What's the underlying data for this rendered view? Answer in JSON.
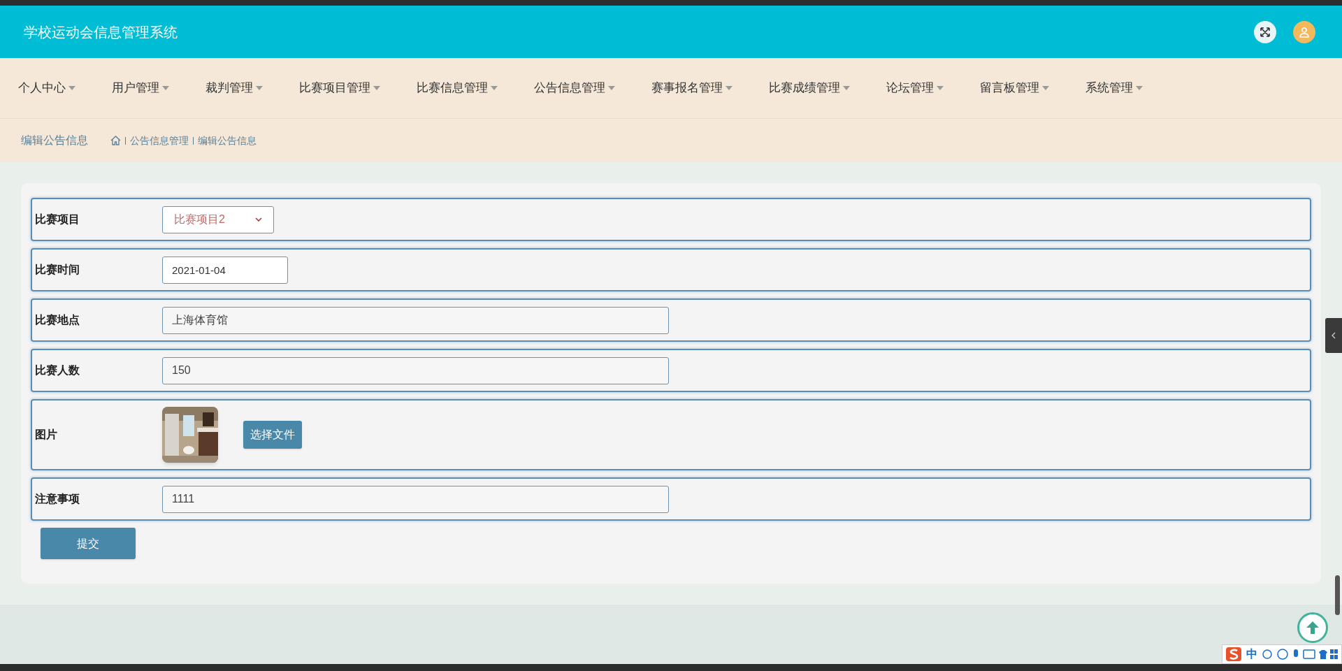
{
  "header": {
    "title": "学校运动会信息管理系统"
  },
  "nav": [
    {
      "label": "个人中心"
    },
    {
      "label": "用户管理"
    },
    {
      "label": "裁判管理"
    },
    {
      "label": "比赛项目管理"
    },
    {
      "label": "比赛信息管理"
    },
    {
      "label": "公告信息管理"
    },
    {
      "label": "赛事报名管理"
    },
    {
      "label": "比赛成绩管理"
    },
    {
      "label": "论坛管理"
    },
    {
      "label": "留言板管理"
    },
    {
      "label": "系统管理"
    }
  ],
  "breadcrumb": {
    "page_title": "编辑公告信息",
    "path": [
      "公告信息管理",
      "编辑公告信息"
    ]
  },
  "form": {
    "fields": [
      {
        "kind": "select",
        "label": "比赛项目",
        "value": "比赛项目2"
      },
      {
        "kind": "date",
        "label": "比赛时间",
        "value": "2021-01-04"
      },
      {
        "kind": "text",
        "label": "比赛地点",
        "value": "上海体育馆"
      },
      {
        "kind": "text",
        "label": "比赛人数",
        "value": "150"
      },
      {
        "label": "图片",
        "button": "选择文件"
      },
      {
        "kind": "text",
        "label": "注意事项",
        "value": "1111"
      }
    ],
    "submit": "提交"
  },
  "ime_bar": {
    "mode": "中"
  }
}
